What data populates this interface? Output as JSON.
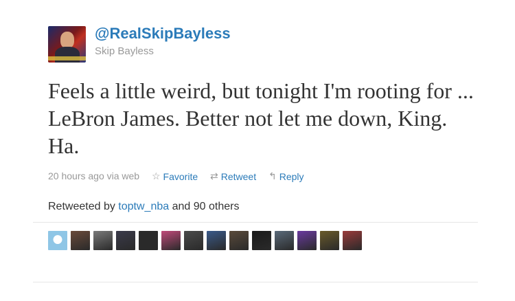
{
  "user": {
    "screen_name": "@RealSkipBayless",
    "full_name": "Skip Bayless"
  },
  "tweet": {
    "text": "Feels a little weird, but tonight I'm rooting for ... LeBron James. Better not let me down, King. Ha.",
    "timestamp": "20 hours ago via web",
    "actions": {
      "favorite": "Favorite",
      "retweet": "Retweet",
      "reply": "Reply"
    }
  },
  "retweets": {
    "prefix": "Retweeted by",
    "user": "toptw_nba",
    "suffix": "and 90 others",
    "avatar_colors": [
      "#8fc6e6",
      "#6a4a3a",
      "#7a7a7a",
      "#3a3a4a",
      "#2a2a2a",
      "#c04a7a",
      "#4a4a4a",
      "#3a5a8a",
      "#5a4a3a",
      "#1a1a1a",
      "#5a6a7a",
      "#6a3aa0",
      "#6a5a2a",
      "#9a3a3a"
    ]
  },
  "icons": {
    "favorite": "star-outline-icon",
    "retweet": "retweet-arrows-icon",
    "reply": "reply-arrow-icon"
  }
}
